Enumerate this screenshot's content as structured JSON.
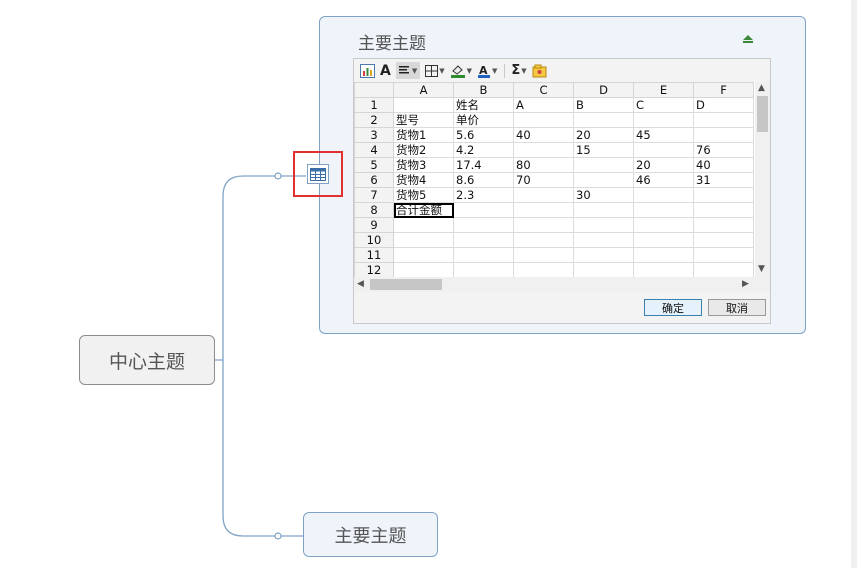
{
  "mindmap": {
    "center_topic": "中心主题",
    "main_topic_card": {
      "title": "主要主题"
    },
    "sub_topic": "主要主题"
  },
  "toolbar": {
    "icons": [
      "chart-icon",
      "font-icon",
      "align-icon",
      "border-icon",
      "fill-color-icon",
      "font-color-icon",
      "sum-icon",
      "insert-object-icon"
    ],
    "font_glyph": "A",
    "sum_glyph": "Σ"
  },
  "sheet": {
    "columns": [
      "A",
      "B",
      "C",
      "D",
      "E",
      "F"
    ],
    "rows": [
      {
        "num": "1",
        "cells": [
          "",
          "姓名",
          "A",
          "B",
          "C",
          "D"
        ]
      },
      {
        "num": "2",
        "cells": [
          "型号",
          "单价",
          "",
          "",
          "",
          ""
        ]
      },
      {
        "num": "3",
        "cells": [
          "货物1",
          "5.6",
          "40",
          "20",
          "45",
          ""
        ]
      },
      {
        "num": "4",
        "cells": [
          "货物2",
          "4.2",
          "",
          "15",
          "",
          "76"
        ]
      },
      {
        "num": "5",
        "cells": [
          "货物3",
          "17.4",
          "80",
          "",
          "20",
          "40"
        ]
      },
      {
        "num": "6",
        "cells": [
          "货物4",
          "8.6",
          "70",
          "",
          "46",
          "31"
        ]
      },
      {
        "num": "7",
        "cells": [
          "货物5",
          "2.3",
          "",
          "30",
          "",
          ""
        ]
      },
      {
        "num": "8",
        "cells": [
          "合计金额",
          "",
          "",
          "",
          "",
          ""
        ]
      },
      {
        "num": "9",
        "cells": [
          "",
          "",
          "",
          "",
          "",
          ""
        ]
      },
      {
        "num": "10",
        "cells": [
          "",
          "",
          "",
          "",
          "",
          ""
        ]
      },
      {
        "num": "11",
        "cells": [
          "",
          "",
          "",
          "",
          "",
          ""
        ]
      },
      {
        "num": "12",
        "cells": [
          "",
          "",
          "",
          "",
          "",
          ""
        ]
      }
    ],
    "selected_cell": "A8"
  },
  "buttons": {
    "ok": "确定",
    "cancel": "取消"
  },
  "colors": {
    "topic_border": "#7fa3c7",
    "highlight": "#e03030"
  }
}
